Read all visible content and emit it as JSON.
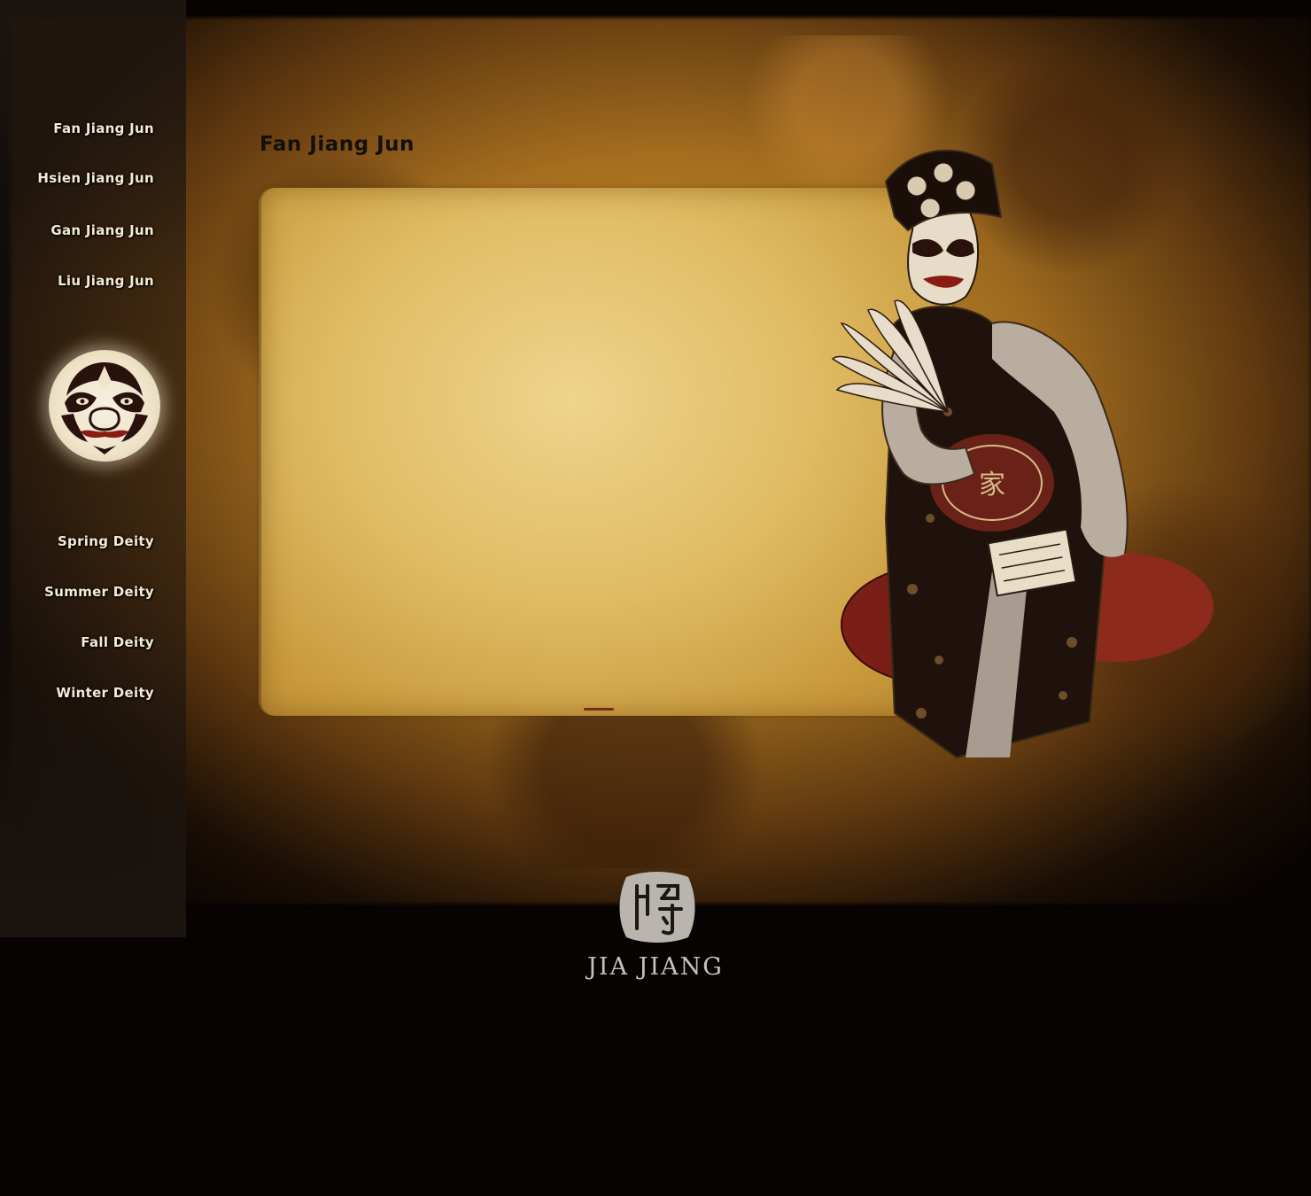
{
  "sidebar": {
    "top_items": [
      {
        "label": "Fan Jiang Jun"
      },
      {
        "label": "Hsien Jiang Jun"
      },
      {
        "label": "Gan Jiang Jun"
      },
      {
        "label": "Liu Jiang Jun"
      }
    ],
    "bottom_items": [
      {
        "label": "Spring Deity"
      },
      {
        "label": "Summer Deity"
      },
      {
        "label": "Fall Deity"
      },
      {
        "label": "Winter Deity"
      }
    ]
  },
  "main": {
    "title": "Fan Jiang Jun"
  },
  "footer": {
    "logo_text": "JIA JIANG"
  },
  "colors": {
    "background": "#070302",
    "nav_text": "#f4ead6",
    "title_text": "#141007",
    "parchment": "#e0bb64",
    "logo_text": "#c7c2bb"
  },
  "icons": {
    "mask_badge": "opera-mask-icon",
    "logo_seal": "jiang-seal-icon"
  }
}
